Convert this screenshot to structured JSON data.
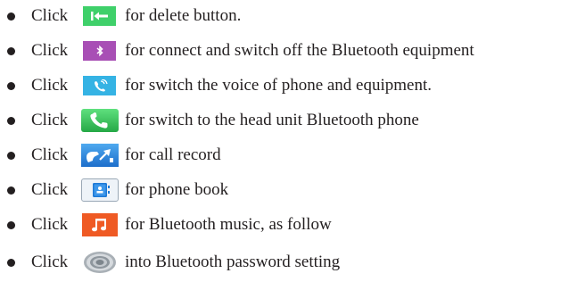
{
  "items": [
    {
      "prefix": "Click",
      "icon": "delete-arrow-icon",
      "text": "for delete button."
    },
    {
      "prefix": "Click",
      "icon": "bluetooth-icon",
      "text": "for connect and switch off the Bluetooth equipment"
    },
    {
      "prefix": "Click",
      "icon": "voice-switch-icon",
      "text": "for switch the voice of phone and equipment."
    },
    {
      "prefix": "Click",
      "icon": "phone-handset-icon",
      "text": "for switch to the head unit Bluetooth phone"
    },
    {
      "prefix": "Click",
      "icon": "call-record-icon",
      "text": "for call record"
    },
    {
      "prefix": "Click",
      "icon": "phone-book-icon",
      "text": "for phone book"
    },
    {
      "prefix": "Click",
      "icon": "music-note-icon",
      "text": "for Bluetooth music, as follow"
    },
    {
      "prefix": "Click",
      "icon": "settings-disc-icon",
      "text": "into Bluetooth password setting"
    }
  ],
  "colors": {
    "delete": "#3fd06a",
    "bluetooth": "#a84fb5",
    "voice": "#35b3e4",
    "phone": "#25a846",
    "call_record": "#1d6ecb",
    "music": "#ef5a24",
    "text": "#231f20"
  }
}
